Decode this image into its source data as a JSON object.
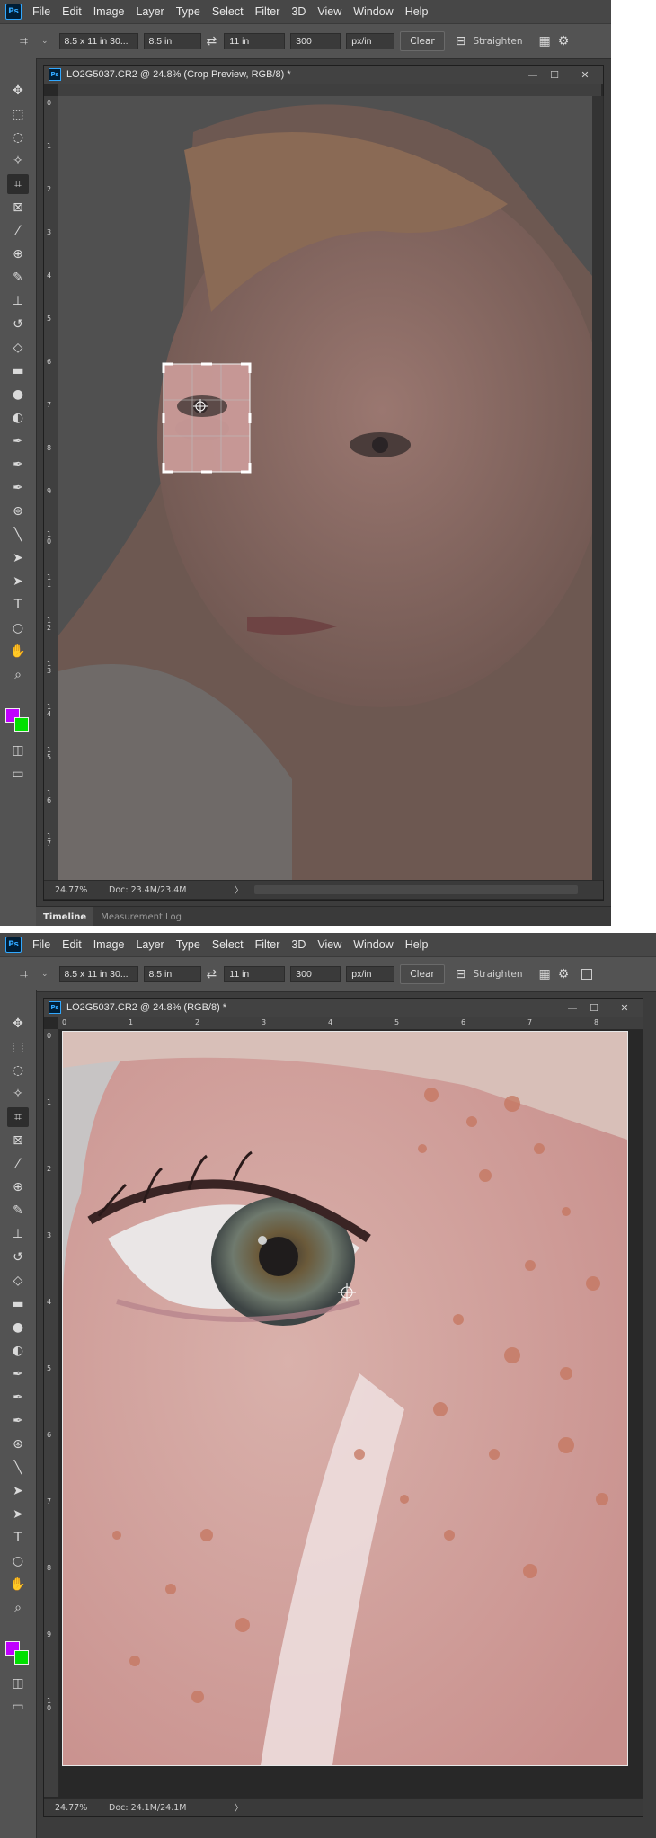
{
  "menu": [
    "File",
    "Edit",
    "Image",
    "Layer",
    "Type",
    "Select",
    "Filter",
    "3D",
    "View",
    "Window",
    "Help"
  ],
  "options": {
    "ratio": "8.5 x 11 in 30...",
    "width": "8.5 in",
    "height": "11 in",
    "resolution": "300",
    "unit": "px/in",
    "clear": "Clear",
    "straighten": "Straighten"
  },
  "doc1": {
    "title": "LO2G5037.CR2 @ 24.8% (Crop Preview, RGB/8) *",
    "zoom": "24.77%",
    "doc_size": "Doc: 23.4M/23.4M"
  },
  "doc2": {
    "title": "LO2G5037.CR2 @ 24.8% (RGB/8) *",
    "zoom": "24.77%",
    "doc_size": "Doc: 24.1M/24.1M"
  },
  "panels": {
    "timeline": "Timeline",
    "measurement": "Measurement Log"
  },
  "ruler1_v": [
    "0",
    "1",
    "2",
    "3",
    "4",
    "5",
    "6",
    "7",
    "8",
    "9",
    "1 0",
    "1 1",
    "1 2",
    "1 3",
    "1 4",
    "1 5",
    "1 6",
    "1 7"
  ],
  "ruler2_h": [
    "0",
    "1",
    "2",
    "3",
    "4",
    "5",
    "6",
    "7",
    "8"
  ],
  "ruler2_v": [
    "0",
    "1",
    "2",
    "3",
    "4",
    "5",
    "6",
    "7",
    "8",
    "9",
    "1 0"
  ],
  "colors": {
    "foreground": "#c000ff",
    "background": "#00e000",
    "accent": "#31a8ff"
  },
  "glyphs": {
    "caret_down": "⌄",
    "swap": "⇄",
    "close": "✕",
    "maximize": "☐",
    "minimize": "—",
    "arrow_right": "〉"
  }
}
